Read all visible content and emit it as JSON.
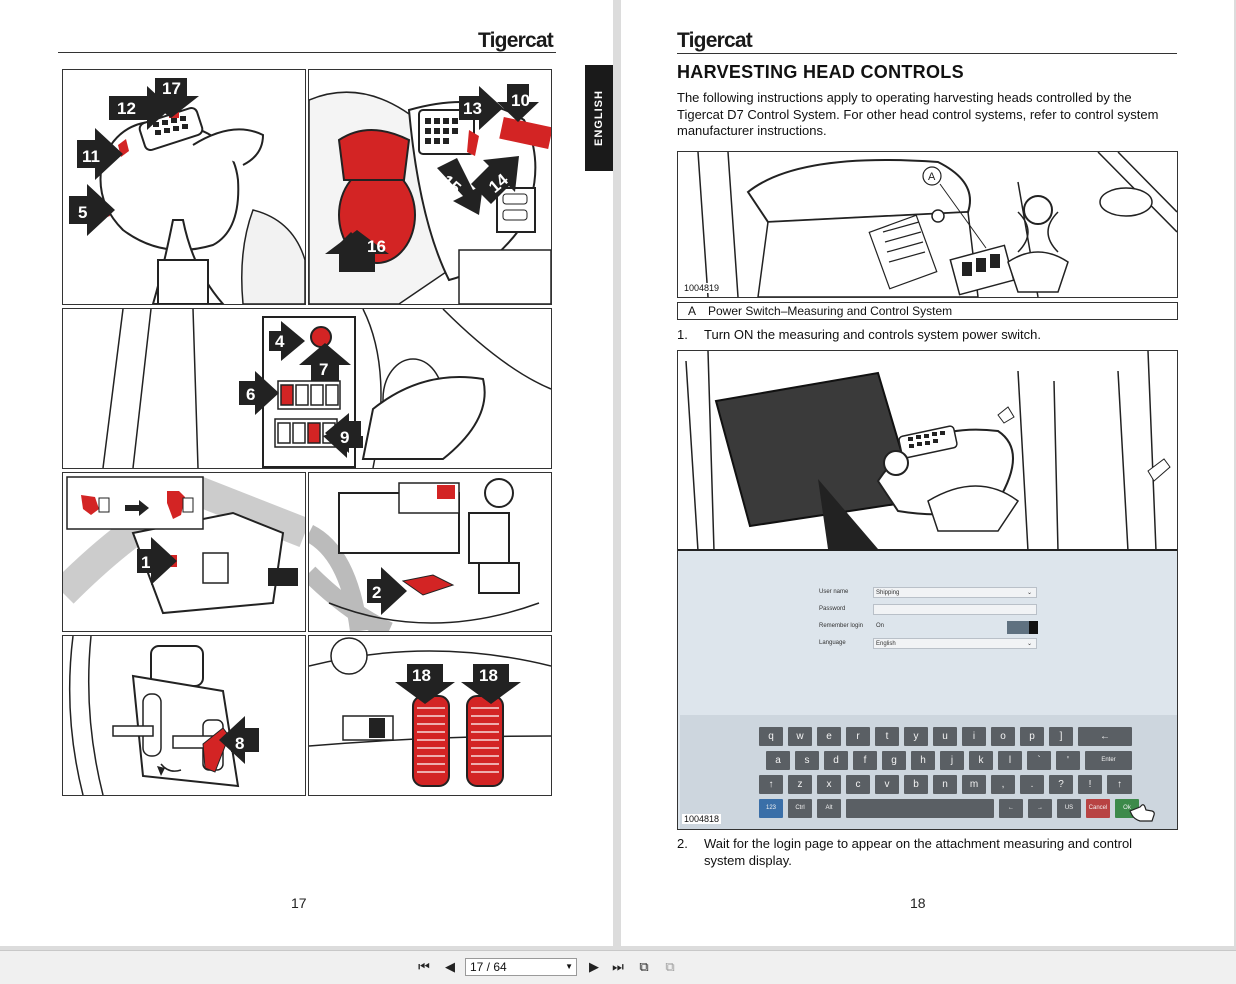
{
  "left_page": {
    "brand": "Tigercat",
    "side_tab": "ENGLISH",
    "page_number": "17",
    "callouts": [
      "17",
      "12",
      "11",
      "5",
      "13",
      "10",
      "15",
      "14",
      "16",
      "4",
      "7",
      "6",
      "9",
      "1",
      "2",
      "8",
      "18",
      "18"
    ]
  },
  "right_page": {
    "brand": "Tigercat",
    "title": "HARVESTING HEAD CONTROLS",
    "intro": "The following instructions apply to operating harvesting heads controlled by the Tigercat D7 Control System. For other head control systems, refer to control system manufacturer instructions.",
    "figure1_id": "1004819",
    "figure1_callout": "A",
    "legend_key": "A",
    "legend_value": "Power Switch–Measuring and Control System",
    "step1_number": "1.",
    "step1_text": "Turn ON the measuring and controls system power switch.",
    "figure2_id": "1004818",
    "step2_number": "2.",
    "step2_text": "Wait for the login page to appear on the attachment measuring and control system display.",
    "page_number": "18"
  },
  "login_screen": {
    "username_label": "User name",
    "username_value": "Shipping",
    "password_label": "Password",
    "remember_label": "Remember login",
    "remember_value": "On",
    "language_label": "Language",
    "language_value": "English",
    "keyboard_rows": [
      [
        "q",
        "w",
        "e",
        "r",
        "t",
        "y",
        "u",
        "i",
        "o",
        "p",
        "]",
        "←"
      ],
      [
        "a",
        "s",
        "d",
        "f",
        "g",
        "h",
        "j",
        "k",
        "l",
        "`",
        "'",
        "Enter"
      ],
      [
        "↑",
        "z",
        "x",
        "c",
        "v",
        "b",
        "n",
        "m",
        ",",
        ".",
        "?",
        "!",
        "↑"
      ],
      [
        "123",
        "Ctrl",
        "Alt",
        "",
        "←",
        "→",
        "US",
        "Cancel",
        "Ok"
      ]
    ]
  },
  "toolbar": {
    "page_indicator": "17 / 64",
    "icons": [
      "first-page-icon",
      "prev-page-icon",
      "next-page-icon",
      "last-page-icon",
      "prev-view-icon",
      "next-view-icon"
    ]
  },
  "colors": {
    "accent_red": "#d32424",
    "dark": "#1a1a1a"
  }
}
